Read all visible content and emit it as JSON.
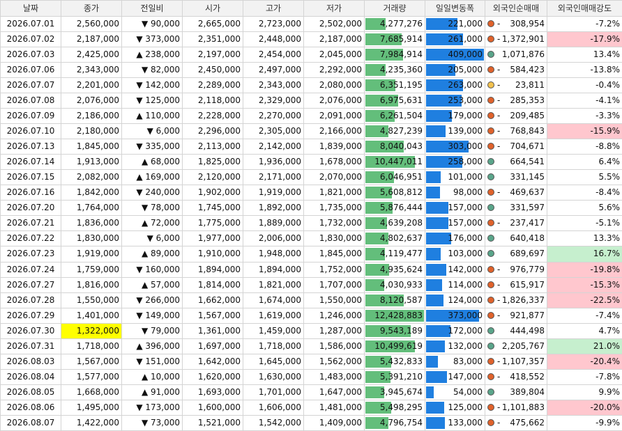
{
  "headers": [
    "날짜",
    "종가",
    "전일비",
    "시가",
    "고가",
    "저가",
    "거래량",
    "일일변동폭",
    "외국인순매매",
    "외국인매매강도"
  ],
  "colors": {
    "up": "#e02020",
    "down": "#1e2ee0",
    "green_dot": "#5aa58a",
    "orange_dot": "#e0622b",
    "yellow_dot": "#f2c14e",
    "volume_bar": "#63be7b",
    "range_bar": "#1f7fe0",
    "highlight": "#ffff00",
    "pos_fill": "#c6efce",
    "neg_fill": "#ffc7ce"
  },
  "rows": [
    {
      "date": "2026.07.01",
      "close": "2,560,000",
      "change": "▼ 90,000",
      "dir": "down",
      "open": "2,665,000",
      "high": "2,723,000",
      "low": "2,502,000",
      "volume": "4,277,276",
      "vol_frac": 0.34,
      "range": "221,000",
      "rng_frac": 0.54,
      "dot": "orange",
      "dash": "-",
      "net": "308,954",
      "strength": "-7.2%",
      "sfill": ""
    },
    {
      "date": "2026.07.02",
      "close": "2,187,000",
      "change": "▼ 373,000",
      "dir": "down",
      "open": "2,351,000",
      "high": "2,448,000",
      "low": "2,187,000",
      "volume": "7,685,914",
      "vol_frac": 0.62,
      "range": "261,000",
      "rng_frac": 0.64,
      "dot": "orange",
      "dash": "-",
      "net": "1,372,901",
      "strength": "-17.9%",
      "sfill": "neg"
    },
    {
      "date": "2026.07.03",
      "close": "2,425,000",
      "change": "▲ 238,000",
      "dir": "up",
      "open": "2,197,000",
      "high": "2,454,000",
      "low": "2,045,000",
      "volume": "7,984,914",
      "vol_frac": 0.64,
      "range": "409,000",
      "rng_frac": 1.0,
      "dot": "green",
      "dash": "",
      "net": "1,071,876",
      "strength": "13.4%",
      "sfill": ""
    },
    {
      "date": "2026.07.06",
      "close": "2,343,000",
      "change": "▼ 82,000",
      "dir": "down",
      "open": "2,450,000",
      "high": "2,497,000",
      "low": "2,292,000",
      "volume": "4,235,360",
      "vol_frac": 0.34,
      "range": "205,000",
      "rng_frac": 0.5,
      "dot": "orange",
      "dash": "-",
      "net": "584,423",
      "strength": "-13.8%",
      "sfill": ""
    },
    {
      "date": "2026.07.07",
      "close": "2,201,000",
      "change": "▼ 142,000",
      "dir": "down",
      "open": "2,289,000",
      "high": "2,343,000",
      "low": "2,080,000",
      "volume": "6,351,195",
      "vol_frac": 0.51,
      "range": "263,000",
      "rng_frac": 0.64,
      "dot": "yellow",
      "dash": "-",
      "net": "23,811",
      "strength": "-0.4%",
      "sfill": ""
    },
    {
      "date": "2026.07.08",
      "close": "2,076,000",
      "change": "▼ 125,000",
      "dir": "down",
      "open": "2,118,000",
      "high": "2,329,000",
      "low": "2,076,000",
      "volume": "6,975,631",
      "vol_frac": 0.56,
      "range": "253,000",
      "rng_frac": 0.62,
      "dot": "orange",
      "dash": "-",
      "net": "285,353",
      "strength": "-4.1%",
      "sfill": ""
    },
    {
      "date": "2026.07.09",
      "close": "2,186,000",
      "change": "▲ 110,000",
      "dir": "up",
      "open": "2,228,000",
      "high": "2,270,000",
      "low": "2,091,000",
      "volume": "6,261,504",
      "vol_frac": 0.5,
      "range": "179,000",
      "rng_frac": 0.44,
      "dot": "orange",
      "dash": "-",
      "net": "209,485",
      "strength": "-3.3%",
      "sfill": ""
    },
    {
      "date": "2026.07.10",
      "close": "2,180,000",
      "change": "▼ 6,000",
      "dir": "down",
      "open": "2,296,000",
      "high": "2,305,000",
      "low": "2,166,000",
      "volume": "4,827,239",
      "vol_frac": 0.39,
      "range": "139,000",
      "rng_frac": 0.34,
      "dot": "orange",
      "dash": "-",
      "net": "768,843",
      "strength": "-15.9%",
      "sfill": "neg"
    },
    {
      "date": "2026.07.13",
      "close": "1,845,000",
      "change": "▼ 335,000",
      "dir": "down",
      "open": "2,113,000",
      "high": "2,142,000",
      "low": "1,839,000",
      "volume": "8,040,043",
      "vol_frac": 0.65,
      "range": "303,000",
      "rng_frac": 0.74,
      "dot": "orange",
      "dash": "-",
      "net": "704,671",
      "strength": "-8.8%",
      "sfill": ""
    },
    {
      "date": "2026.07.14",
      "close": "1,913,000",
      "change": "▲ 68,000",
      "dir": "up",
      "open": "1,825,000",
      "high": "1,936,000",
      "low": "1,678,000",
      "volume": "10,447,011",
      "vol_frac": 0.84,
      "range": "258,000",
      "rng_frac": 0.63,
      "dot": "green",
      "dash": "",
      "net": "664,541",
      "strength": "6.4%",
      "sfill": ""
    },
    {
      "date": "2026.07.15",
      "close": "2,082,000",
      "change": "▲ 169,000",
      "dir": "up",
      "open": "2,120,000",
      "high": "2,171,000",
      "low": "2,070,000",
      "volume": "6,046,951",
      "vol_frac": 0.49,
      "range": "101,000",
      "rng_frac": 0.25,
      "dot": "green",
      "dash": "",
      "net": "331,145",
      "strength": "5.5%",
      "sfill": ""
    },
    {
      "date": "2026.07.16",
      "close": "1,842,000",
      "change": "▼ 240,000",
      "dir": "down",
      "open": "1,902,000",
      "high": "1,919,000",
      "low": "1,821,000",
      "volume": "5,608,812",
      "vol_frac": 0.45,
      "range": "98,000",
      "rng_frac": 0.24,
      "dot": "orange",
      "dash": "-",
      "net": "469,637",
      "strength": "-8.4%",
      "sfill": ""
    },
    {
      "date": "2026.07.20",
      "close": "1,764,000",
      "change": "▼ 78,000",
      "dir": "down",
      "open": "1,745,000",
      "high": "1,892,000",
      "low": "1,735,000",
      "volume": "5,876,444",
      "vol_frac": 0.47,
      "range": "157,000",
      "rng_frac": 0.38,
      "dot": "green",
      "dash": "",
      "net": "331,597",
      "strength": "5.6%",
      "sfill": ""
    },
    {
      "date": "2026.07.21",
      "close": "1,836,000",
      "change": "▲ 72,000",
      "dir": "up",
      "open": "1,775,000",
      "high": "1,889,000",
      "low": "1,732,000",
      "volume": "4,639,208",
      "vol_frac": 0.37,
      "range": "157,000",
      "rng_frac": 0.38,
      "dot": "orange",
      "dash": "-",
      "net": "237,417",
      "strength": "-5.1%",
      "sfill": ""
    },
    {
      "date": "2026.07.22",
      "close": "1,830,000",
      "change": "▼ 6,000",
      "dir": "down",
      "open": "1,977,000",
      "high": "2,006,000",
      "low": "1,830,000",
      "volume": "4,802,637",
      "vol_frac": 0.39,
      "range": "176,000",
      "rng_frac": 0.43,
      "dot": "green",
      "dash": "",
      "net": "640,418",
      "strength": "13.3%",
      "sfill": ""
    },
    {
      "date": "2026.07.23",
      "close": "1,919,000",
      "change": "▲ 89,000",
      "dir": "up",
      "open": "1,910,000",
      "high": "1,948,000",
      "low": "1,845,000",
      "volume": "4,119,477",
      "vol_frac": 0.33,
      "range": "103,000",
      "rng_frac": 0.25,
      "dot": "green",
      "dash": "",
      "net": "689,697",
      "strength": "16.7%",
      "sfill": "pos"
    },
    {
      "date": "2026.07.24",
      "close": "1,759,000",
      "change": "▼ 160,000",
      "dir": "down",
      "open": "1,894,000",
      "high": "1,894,000",
      "low": "1,752,000",
      "volume": "4,935,624",
      "vol_frac": 0.4,
      "range": "142,000",
      "rng_frac": 0.35,
      "dot": "orange",
      "dash": "-",
      "net": "976,779",
      "strength": "-19.8%",
      "sfill": "neg"
    },
    {
      "date": "2026.07.27",
      "close": "1,816,000",
      "change": "▲ 57,000",
      "dir": "up",
      "open": "1,814,000",
      "high": "1,821,000",
      "low": "1,707,000",
      "volume": "4,030,933",
      "vol_frac": 0.32,
      "range": "114,000",
      "rng_frac": 0.28,
      "dot": "orange",
      "dash": "-",
      "net": "615,917",
      "strength": "-15.3%",
      "sfill": "neg"
    },
    {
      "date": "2026.07.28",
      "close": "1,550,000",
      "change": "▼ 266,000",
      "dir": "down",
      "open": "1,662,000",
      "high": "1,674,000",
      "low": "1,550,000",
      "volume": "8,120,587",
      "vol_frac": 0.65,
      "range": "124,000",
      "rng_frac": 0.3,
      "dot": "orange",
      "dash": "-",
      "net": "1,826,337",
      "strength": "-22.5%",
      "sfill": "neg"
    },
    {
      "date": "2026.07.29",
      "close": "1,401,000",
      "change": "▼ 149,000",
      "dir": "down",
      "open": "1,567,000",
      "high": "1,619,000",
      "low": "1,246,000",
      "volume": "12,428,883",
      "vol_frac": 1.0,
      "range": "373,000",
      "rng_frac": 0.91,
      "dot": "orange",
      "dash": "-",
      "net": "921,877",
      "strength": "-7.4%",
      "sfill": ""
    },
    {
      "date": "2026.07.30",
      "close": "1,322,000",
      "change": "▼ 79,000",
      "dir": "down",
      "open": "1,361,000",
      "high": "1,459,000",
      "low": "1,287,000",
      "volume": "9,543,189",
      "vol_frac": 0.77,
      "range": "172,000",
      "rng_frac": 0.42,
      "dot": "green",
      "dash": "",
      "net": "444,498",
      "strength": "4.7%",
      "sfill": "",
      "highlight": true
    },
    {
      "date": "2026.07.31",
      "close": "1,718,000",
      "change": "▲ 396,000",
      "dir": "up",
      "open": "1,697,000",
      "high": "1,718,000",
      "low": "1,586,000",
      "volume": "10,499,619",
      "vol_frac": 0.84,
      "range": "132,000",
      "rng_frac": 0.32,
      "dot": "green",
      "dash": "",
      "net": "2,205,767",
      "strength": "21.0%",
      "sfill": "pos"
    },
    {
      "date": "2026.08.03",
      "close": "1,567,000",
      "change": "▼ 151,000",
      "dir": "down",
      "open": "1,642,000",
      "high": "1,645,000",
      "low": "1,562,000",
      "volume": "5,432,833",
      "vol_frac": 0.44,
      "range": "83,000",
      "rng_frac": 0.2,
      "dot": "orange",
      "dash": "-",
      "net": "1,107,357",
      "strength": "-20.4%",
      "sfill": "neg"
    },
    {
      "date": "2026.08.04",
      "close": "1,577,000",
      "change": "▲ 10,000",
      "dir": "up",
      "open": "1,620,000",
      "high": "1,630,000",
      "low": "1,483,000",
      "volume": "5,391,210",
      "vol_frac": 0.43,
      "range": "147,000",
      "rng_frac": 0.36,
      "dot": "orange",
      "dash": "-",
      "net": "418,552",
      "strength": "-7.8%",
      "sfill": ""
    },
    {
      "date": "2026.08.05",
      "close": "1,668,000",
      "change": "▲ 91,000",
      "dir": "up",
      "open": "1,693,000",
      "high": "1,701,000",
      "low": "1,647,000",
      "volume": "3,945,674",
      "vol_frac": 0.32,
      "range": "54,000",
      "rng_frac": 0.13,
      "dot": "green",
      "dash": "",
      "net": "389,804",
      "strength": "9.9%",
      "sfill": ""
    },
    {
      "date": "2026.08.06",
      "close": "1,495,000",
      "change": "▼ 173,000",
      "dir": "down",
      "open": "1,600,000",
      "high": "1,606,000",
      "low": "1,481,000",
      "volume": "5,498,295",
      "vol_frac": 0.44,
      "range": "125,000",
      "rng_frac": 0.31,
      "dot": "orange",
      "dash": "-",
      "net": "1,101,883",
      "strength": "-20.0%",
      "sfill": "neg"
    },
    {
      "date": "2026.08.07",
      "close": "1,422,000",
      "change": "▼ 73,000",
      "dir": "down",
      "open": "1,521,000",
      "high": "1,542,000",
      "low": "1,409,000",
      "volume": "4,796,754",
      "vol_frac": 0.39,
      "range": "133,000",
      "rng_frac": 0.33,
      "dot": "orange",
      "dash": "-",
      "net": "475,662",
      "strength": "-9.9%",
      "sfill": ""
    }
  ]
}
